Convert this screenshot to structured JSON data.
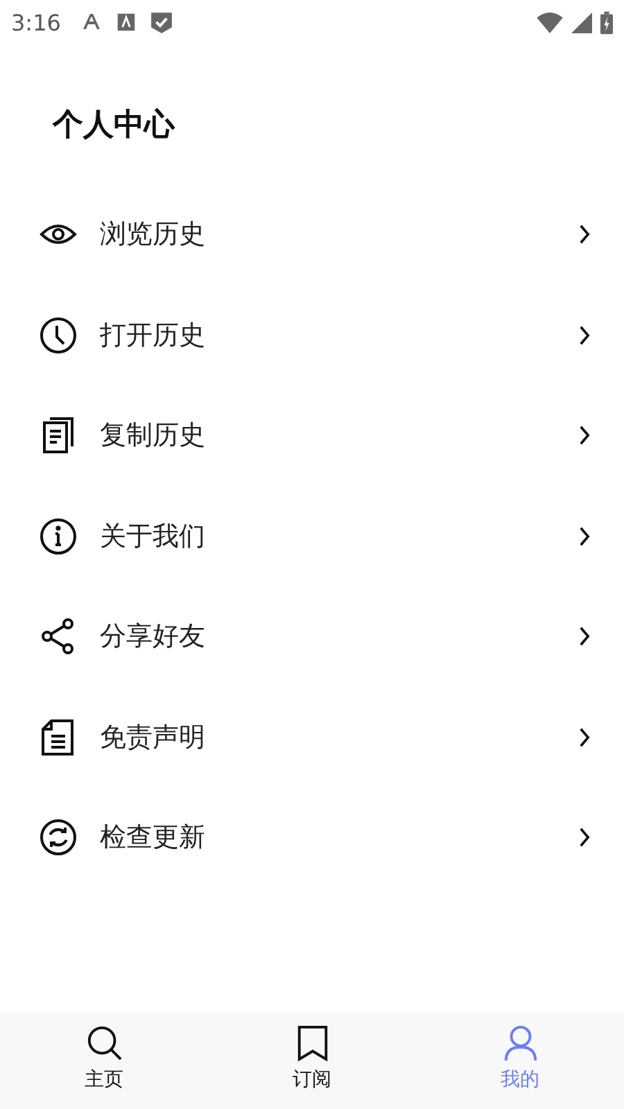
{
  "status_bar": {
    "time": "3:16"
  },
  "title": "个人中心",
  "menu": [
    {
      "label": "浏览历史",
      "kind": "eye"
    },
    {
      "label": "打开历史",
      "kind": "clock"
    },
    {
      "label": "复制历史",
      "kind": "copy"
    },
    {
      "label": "关于我们",
      "kind": "info"
    },
    {
      "label": "分享好友",
      "kind": "share"
    },
    {
      "label": "免责声明",
      "kind": "doc"
    },
    {
      "label": "检查更新",
      "kind": "refresh"
    }
  ],
  "tabs": [
    {
      "label": "主页",
      "kind": "search",
      "selected": false
    },
    {
      "label": "订阅",
      "kind": "bookmark",
      "selected": false
    },
    {
      "label": "我的",
      "kind": "person",
      "selected": true
    }
  ]
}
